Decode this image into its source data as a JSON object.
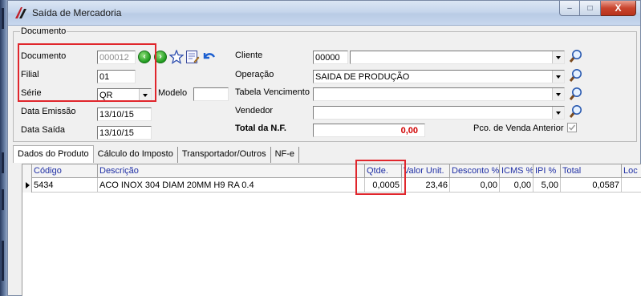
{
  "window": {
    "title": "Saída de Mercadoria",
    "min_glyph": "–",
    "max_glyph": "□",
    "close_glyph": "X"
  },
  "documento_group": {
    "caption": "Documento",
    "documento": {
      "label": "Documento",
      "value": "000012"
    },
    "filial": {
      "label": "Filial",
      "value": "01"
    },
    "serie": {
      "label": "Série",
      "value": "QR"
    },
    "modelo": {
      "label": "Modelo",
      "value": ""
    },
    "data_emissao": {
      "label": "Data Emissão",
      "value": "13/10/15"
    },
    "data_saida": {
      "label": "Data Saída",
      "value": "13/10/15"
    },
    "cliente": {
      "label": "Cliente",
      "code": "00000",
      "name": ""
    },
    "operacao": {
      "label": "Operação",
      "value": "SAIDA DE PRODUÇÃO"
    },
    "tabela_vencimento": {
      "label": "Tabela Vencimento",
      "value": ""
    },
    "vendedor": {
      "label": "Vendedor",
      "value": ""
    },
    "total_nf": {
      "label": "Total da N.F.",
      "value": "0,00"
    },
    "pco_venda_anterior": {
      "label": "Pco. de Venda Anterior",
      "checked": true
    }
  },
  "tabs": [
    {
      "label": "Dados do Produto"
    },
    {
      "label": "Cálculo do Imposto"
    },
    {
      "label": "Transportador/Outros"
    },
    {
      "label": "NF-e"
    }
  ],
  "grid": {
    "columns": [
      "Código",
      "Descrição",
      "Qtde.",
      "Valor Unit.",
      "Desconto %",
      "ICMS %",
      "IPI %",
      "Total",
      "Loc"
    ],
    "rows": [
      {
        "codigo": "5434",
        "descricao": "ACO INOX 304 DIAM 20MM H9 RA 0.4",
        "qtde": "0,0005",
        "valor_unit": "23,46",
        "desconto": "0,00",
        "icms": "0,00",
        "ipi": "5,00",
        "total": "0,0587",
        "loc": ""
      }
    ]
  },
  "colors": {
    "highlight_box": "#e0262c",
    "header_text": "#1f2fa5",
    "total_text": "#d00000"
  },
  "icons": [
    "app-logo-icon",
    "prev-record-icon",
    "next-record-icon",
    "favorite-star-icon",
    "edit-document-icon",
    "undo-arrow-icon",
    "search-magnifier-icon"
  ]
}
